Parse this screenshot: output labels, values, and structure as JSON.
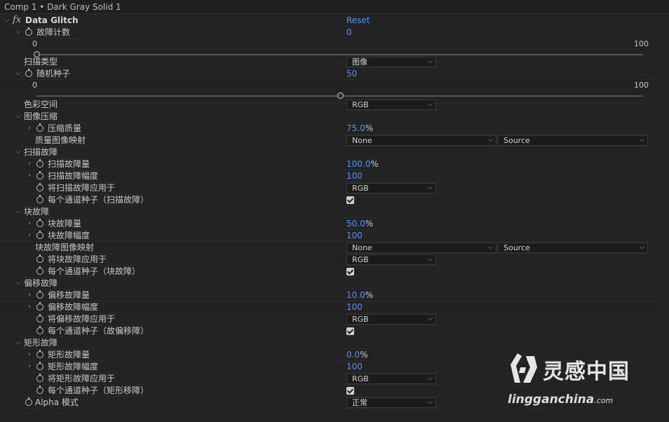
{
  "header": {
    "title": "Comp 1 • Dark Gray Solid 1"
  },
  "effect": {
    "name": "Data Glitch",
    "reset": "Reset",
    "fx": "fx"
  },
  "glitch_count": {
    "label": "故障计数",
    "value": "0",
    "min": "0",
    "max": "100",
    "slider_value": 0
  },
  "scan_type": {
    "label": "扫描类型",
    "value": "图像"
  },
  "random_seed": {
    "label": "随机种子",
    "value": "50",
    "min": "0",
    "max": "100",
    "slider_value": 50
  },
  "color_space": {
    "label": "色彩空间",
    "value": "RGB"
  },
  "image_compress": {
    "label": "图像压缩",
    "quality": {
      "label": "压缩质量",
      "value": "75.0",
      "unit": "%"
    },
    "quality_map": {
      "label": "质量图像映射",
      "value1": "None",
      "value2": "Source"
    }
  },
  "scan_glitch": {
    "label": "扫描故障",
    "amount": {
      "label": "扫描故障量",
      "value": "100.0",
      "unit": "%"
    },
    "magnitude": {
      "label": "扫描故障幅度",
      "value": "100"
    },
    "apply_to": {
      "label": "将扫描故障应用于",
      "value": "RGB"
    },
    "seed_per_channel": {
      "label": "每个通道种子（扫描故障）",
      "checked": true
    }
  },
  "block_glitch": {
    "label": "块故障",
    "amount": {
      "label": "块故障量",
      "value": "50.0",
      "unit": "%"
    },
    "magnitude": {
      "label": "块故障幅度",
      "value": "100"
    },
    "map": {
      "label": "块故障图像映射",
      "value1": "None",
      "value2": "Source"
    },
    "apply_to": {
      "label": "将块故障应用于",
      "value": "RGB"
    },
    "seed_per_channel": {
      "label": "每个通道种子（块故障）",
      "checked": true
    }
  },
  "offset_glitch": {
    "label": "偏移故障",
    "amount": {
      "label": "偏移故障量",
      "value": "10.0",
      "unit": "%"
    },
    "magnitude": {
      "label": "偏移故障幅度",
      "value": "100"
    },
    "apply_to": {
      "label": "将偏移故障应用于",
      "value": "RGB"
    },
    "seed_per_channel": {
      "label": "每个通道种子（故偏移障）",
      "checked": true
    }
  },
  "rect_glitch": {
    "label": "矩形故障",
    "amount": {
      "label": "矩形故障量",
      "value": "0.0",
      "unit": "%"
    },
    "magnitude": {
      "label": "矩形故障幅度",
      "value": "100"
    },
    "apply_to": {
      "label": "将矩形故障应用于",
      "value": "RGB"
    },
    "seed_per_channel": {
      "label": "每个通道种子（矩形移障）",
      "checked": true
    }
  },
  "alpha_mode": {
    "label": "Alpha 模式",
    "value": "正常"
  },
  "watermark": {
    "cn": "灵感中国",
    "en": "lingganchina",
    "en_suffix": ".com"
  },
  "colors": {
    "accent": "#4f93ff",
    "panel_bg": "#232323",
    "text": "#c9c9c9"
  }
}
